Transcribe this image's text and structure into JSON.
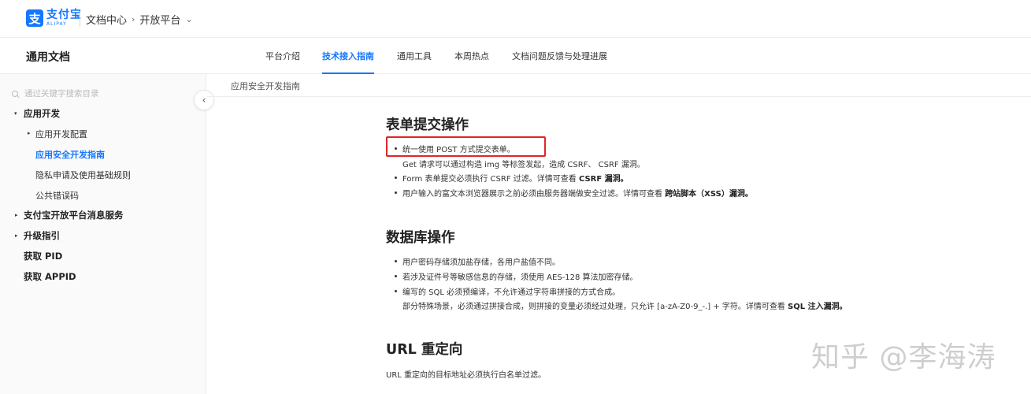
{
  "brand": {
    "mark": "支",
    "name": "支付宝",
    "name_en": "ALIPAY"
  },
  "breadcrumb": {
    "section": "文档中心",
    "sep": "›",
    "current": "开放平台",
    "dropdown": "⌄"
  },
  "subnav": {
    "title": "通用文档",
    "tabs": [
      {
        "label": "平台介绍"
      },
      {
        "label": "技术接入指南"
      },
      {
        "label": "通用工具"
      },
      {
        "label": "本周热点"
      },
      {
        "label": "文档问题反馈与处理进展"
      }
    ],
    "active_tab": "技术接入指南"
  },
  "sidebar": {
    "search_placeholder": "通过关键字搜索目录",
    "items": [
      {
        "label": "应用开发",
        "caret": "▾"
      },
      {
        "label": "应用开发配置",
        "caret": "▸"
      },
      {
        "label": "应用安全开发指南"
      },
      {
        "label": "隐私申请及使用基础规则"
      },
      {
        "label": "公共错误码"
      },
      {
        "label": "支付宝开放平台消息服务",
        "caret": "▸"
      },
      {
        "label": "升级指引",
        "caret": "▸"
      },
      {
        "label": "获取 PID"
      },
      {
        "label": "获取 APPID"
      }
    ],
    "collapse_glyph": "‹"
  },
  "doc": {
    "breadcrumb_title": "应用安全开发指南",
    "sections": [
      {
        "heading": "表单提交操作",
        "lines": [
          "统一使用 POST 方式提交表单。",
          "Get 请求可以通过构造 img 等标签发起，造成 CSRF、 CSRF 漏洞。",
          "Form 表单提交必须执行 CSRF 过滤。详情可查看 ",
          "CSRF 漏洞。",
          "用户输入的富文本浏览器展示之前必须由服务器端做安全过滤。详情可查看 ",
          "跨站脚本（XSS）漏洞。"
        ]
      },
      {
        "heading": "数据库操作",
        "lines": [
          "用户密码存储须加盐存储，各用户盐值不同。",
          "若涉及证件号等敏感信息的存储，须使用 AES-128 算法加密存储。",
          "编写的 SQL 必须预编译，不允许通过字符串拼接的方式合成。",
          "部分特殊场景，必须通过拼接合成，则拼接的变量必须经过处理，只允许 [a-zA-Z0-9_-.] + 字符。详情可查看 ",
          "SQL 注入漏洞。"
        ]
      },
      {
        "heading": "URL 重定向",
        "lines": [
          "URL 重定向的目标地址必须执行白名单过滤。"
        ]
      }
    ]
  },
  "watermark": "知乎 @李海涛"
}
